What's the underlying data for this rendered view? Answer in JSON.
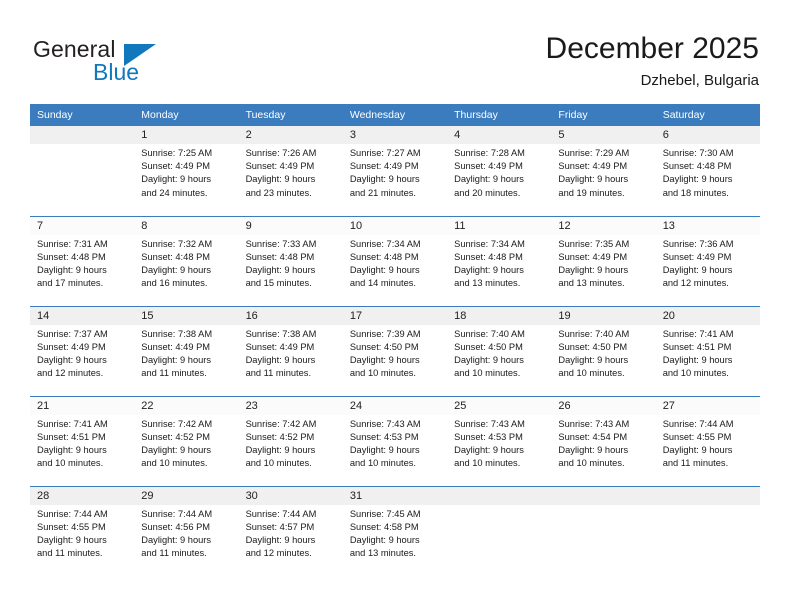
{
  "logo": {
    "word_top": "General",
    "word_bottom": "Blue",
    "triangle_icon": "blue-triangle-icon",
    "accent_color": "#1278be"
  },
  "header": {
    "title": "December 2025",
    "subtitle": "Dzhebel, Bulgaria"
  },
  "theme": {
    "header_row_bg": "#3a7cbe",
    "header_row_text": "#ffffff",
    "daynum_band_odd": "#f0f0f0",
    "daynum_band_even": "#fbfbfb",
    "week_separator": "#3a7cbe"
  },
  "calendar": {
    "weekday_headers": [
      "Sunday",
      "Monday",
      "Tuesday",
      "Wednesday",
      "Thursday",
      "Friday",
      "Saturday"
    ],
    "weeks": [
      [
        {
          "day": "",
          "sunrise": "",
          "sunset": "",
          "daylight1": "",
          "daylight2": ""
        },
        {
          "day": "1",
          "sunrise": "Sunrise: 7:25 AM",
          "sunset": "Sunset: 4:49 PM",
          "daylight1": "Daylight: 9 hours",
          "daylight2": "and 24 minutes."
        },
        {
          "day": "2",
          "sunrise": "Sunrise: 7:26 AM",
          "sunset": "Sunset: 4:49 PM",
          "daylight1": "Daylight: 9 hours",
          "daylight2": "and 23 minutes."
        },
        {
          "day": "3",
          "sunrise": "Sunrise: 7:27 AM",
          "sunset": "Sunset: 4:49 PM",
          "daylight1": "Daylight: 9 hours",
          "daylight2": "and 21 minutes."
        },
        {
          "day": "4",
          "sunrise": "Sunrise: 7:28 AM",
          "sunset": "Sunset: 4:49 PM",
          "daylight1": "Daylight: 9 hours",
          "daylight2": "and 20 minutes."
        },
        {
          "day": "5",
          "sunrise": "Sunrise: 7:29 AM",
          "sunset": "Sunset: 4:49 PM",
          "daylight1": "Daylight: 9 hours",
          "daylight2": "and 19 minutes."
        },
        {
          "day": "6",
          "sunrise": "Sunrise: 7:30 AM",
          "sunset": "Sunset: 4:48 PM",
          "daylight1": "Daylight: 9 hours",
          "daylight2": "and 18 minutes."
        }
      ],
      [
        {
          "day": "7",
          "sunrise": "Sunrise: 7:31 AM",
          "sunset": "Sunset: 4:48 PM",
          "daylight1": "Daylight: 9 hours",
          "daylight2": "and 17 minutes."
        },
        {
          "day": "8",
          "sunrise": "Sunrise: 7:32 AM",
          "sunset": "Sunset: 4:48 PM",
          "daylight1": "Daylight: 9 hours",
          "daylight2": "and 16 minutes."
        },
        {
          "day": "9",
          "sunrise": "Sunrise: 7:33 AM",
          "sunset": "Sunset: 4:48 PM",
          "daylight1": "Daylight: 9 hours",
          "daylight2": "and 15 minutes."
        },
        {
          "day": "10",
          "sunrise": "Sunrise: 7:34 AM",
          "sunset": "Sunset: 4:48 PM",
          "daylight1": "Daylight: 9 hours",
          "daylight2": "and 14 minutes."
        },
        {
          "day": "11",
          "sunrise": "Sunrise: 7:34 AM",
          "sunset": "Sunset: 4:48 PM",
          "daylight1": "Daylight: 9 hours",
          "daylight2": "and 13 minutes."
        },
        {
          "day": "12",
          "sunrise": "Sunrise: 7:35 AM",
          "sunset": "Sunset: 4:49 PM",
          "daylight1": "Daylight: 9 hours",
          "daylight2": "and 13 minutes."
        },
        {
          "day": "13",
          "sunrise": "Sunrise: 7:36 AM",
          "sunset": "Sunset: 4:49 PM",
          "daylight1": "Daylight: 9 hours",
          "daylight2": "and 12 minutes."
        }
      ],
      [
        {
          "day": "14",
          "sunrise": "Sunrise: 7:37 AM",
          "sunset": "Sunset: 4:49 PM",
          "daylight1": "Daylight: 9 hours",
          "daylight2": "and 12 minutes."
        },
        {
          "day": "15",
          "sunrise": "Sunrise: 7:38 AM",
          "sunset": "Sunset: 4:49 PM",
          "daylight1": "Daylight: 9 hours",
          "daylight2": "and 11 minutes."
        },
        {
          "day": "16",
          "sunrise": "Sunrise: 7:38 AM",
          "sunset": "Sunset: 4:49 PM",
          "daylight1": "Daylight: 9 hours",
          "daylight2": "and 11 minutes."
        },
        {
          "day": "17",
          "sunrise": "Sunrise: 7:39 AM",
          "sunset": "Sunset: 4:50 PM",
          "daylight1": "Daylight: 9 hours",
          "daylight2": "and 10 minutes."
        },
        {
          "day": "18",
          "sunrise": "Sunrise: 7:40 AM",
          "sunset": "Sunset: 4:50 PM",
          "daylight1": "Daylight: 9 hours",
          "daylight2": "and 10 minutes."
        },
        {
          "day": "19",
          "sunrise": "Sunrise: 7:40 AM",
          "sunset": "Sunset: 4:50 PM",
          "daylight1": "Daylight: 9 hours",
          "daylight2": "and 10 minutes."
        },
        {
          "day": "20",
          "sunrise": "Sunrise: 7:41 AM",
          "sunset": "Sunset: 4:51 PM",
          "daylight1": "Daylight: 9 hours",
          "daylight2": "and 10 minutes."
        }
      ],
      [
        {
          "day": "21",
          "sunrise": "Sunrise: 7:41 AM",
          "sunset": "Sunset: 4:51 PM",
          "daylight1": "Daylight: 9 hours",
          "daylight2": "and 10 minutes."
        },
        {
          "day": "22",
          "sunrise": "Sunrise: 7:42 AM",
          "sunset": "Sunset: 4:52 PM",
          "daylight1": "Daylight: 9 hours",
          "daylight2": "and 10 minutes."
        },
        {
          "day": "23",
          "sunrise": "Sunrise: 7:42 AM",
          "sunset": "Sunset: 4:52 PM",
          "daylight1": "Daylight: 9 hours",
          "daylight2": "and 10 minutes."
        },
        {
          "day": "24",
          "sunrise": "Sunrise: 7:43 AM",
          "sunset": "Sunset: 4:53 PM",
          "daylight1": "Daylight: 9 hours",
          "daylight2": "and 10 minutes."
        },
        {
          "day": "25",
          "sunrise": "Sunrise: 7:43 AM",
          "sunset": "Sunset: 4:53 PM",
          "daylight1": "Daylight: 9 hours",
          "daylight2": "and 10 minutes."
        },
        {
          "day": "26",
          "sunrise": "Sunrise: 7:43 AM",
          "sunset": "Sunset: 4:54 PM",
          "daylight1": "Daylight: 9 hours",
          "daylight2": "and 10 minutes."
        },
        {
          "day": "27",
          "sunrise": "Sunrise: 7:44 AM",
          "sunset": "Sunset: 4:55 PM",
          "daylight1": "Daylight: 9 hours",
          "daylight2": "and 11 minutes."
        }
      ],
      [
        {
          "day": "28",
          "sunrise": "Sunrise: 7:44 AM",
          "sunset": "Sunset: 4:55 PM",
          "daylight1": "Daylight: 9 hours",
          "daylight2": "and 11 minutes."
        },
        {
          "day": "29",
          "sunrise": "Sunrise: 7:44 AM",
          "sunset": "Sunset: 4:56 PM",
          "daylight1": "Daylight: 9 hours",
          "daylight2": "and 11 minutes."
        },
        {
          "day": "30",
          "sunrise": "Sunrise: 7:44 AM",
          "sunset": "Sunset: 4:57 PM",
          "daylight1": "Daylight: 9 hours",
          "daylight2": "and 12 minutes."
        },
        {
          "day": "31",
          "sunrise": "Sunrise: 7:45 AM",
          "sunset": "Sunset: 4:58 PM",
          "daylight1": "Daylight: 9 hours",
          "daylight2": "and 13 minutes."
        },
        {
          "day": "",
          "sunrise": "",
          "sunset": "",
          "daylight1": "",
          "daylight2": ""
        },
        {
          "day": "",
          "sunrise": "",
          "sunset": "",
          "daylight1": "",
          "daylight2": ""
        },
        {
          "day": "",
          "sunrise": "",
          "sunset": "",
          "daylight1": "",
          "daylight2": ""
        }
      ]
    ]
  }
}
